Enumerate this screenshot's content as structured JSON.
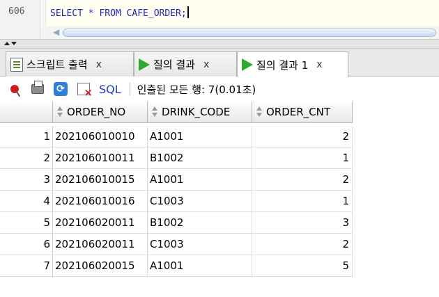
{
  "editor": {
    "line_number": "606",
    "code": "SELECT * FROM CAFE_ORDER;"
  },
  "tabs": [
    {
      "label": "스크립트 출력",
      "close": "x",
      "icon": "script-output-icon"
    },
    {
      "label": "질의 결과",
      "close": "x",
      "icon": "run-query-icon"
    },
    {
      "label": "질의 결과 1",
      "close": "x",
      "icon": "run-query-icon"
    }
  ],
  "toolbar": {
    "sql_label": "SQL",
    "status": "인출된 모든 행: 7(0.01초)"
  },
  "table": {
    "columns": [
      "ORDER_NO",
      "DRINK_CODE",
      "ORDER_CNT"
    ],
    "rows": [
      [
        "1",
        "202106010010",
        "A1001",
        "2"
      ],
      [
        "2",
        "202106010011",
        "B1002",
        "1"
      ],
      [
        "3",
        "202106010015",
        "A1001",
        "2"
      ],
      [
        "4",
        "202106010016",
        "C1003",
        "1"
      ],
      [
        "5",
        "202106020011",
        "B1002",
        "3"
      ],
      [
        "6",
        "202106020011",
        "C1003",
        "2"
      ],
      [
        "7",
        "202106020015",
        "A1001",
        "5"
      ]
    ]
  },
  "colors": {
    "code_keyword": "#1c28b8",
    "run_green": "#2eab2e",
    "sql_link": "#1a3ec7"
  }
}
